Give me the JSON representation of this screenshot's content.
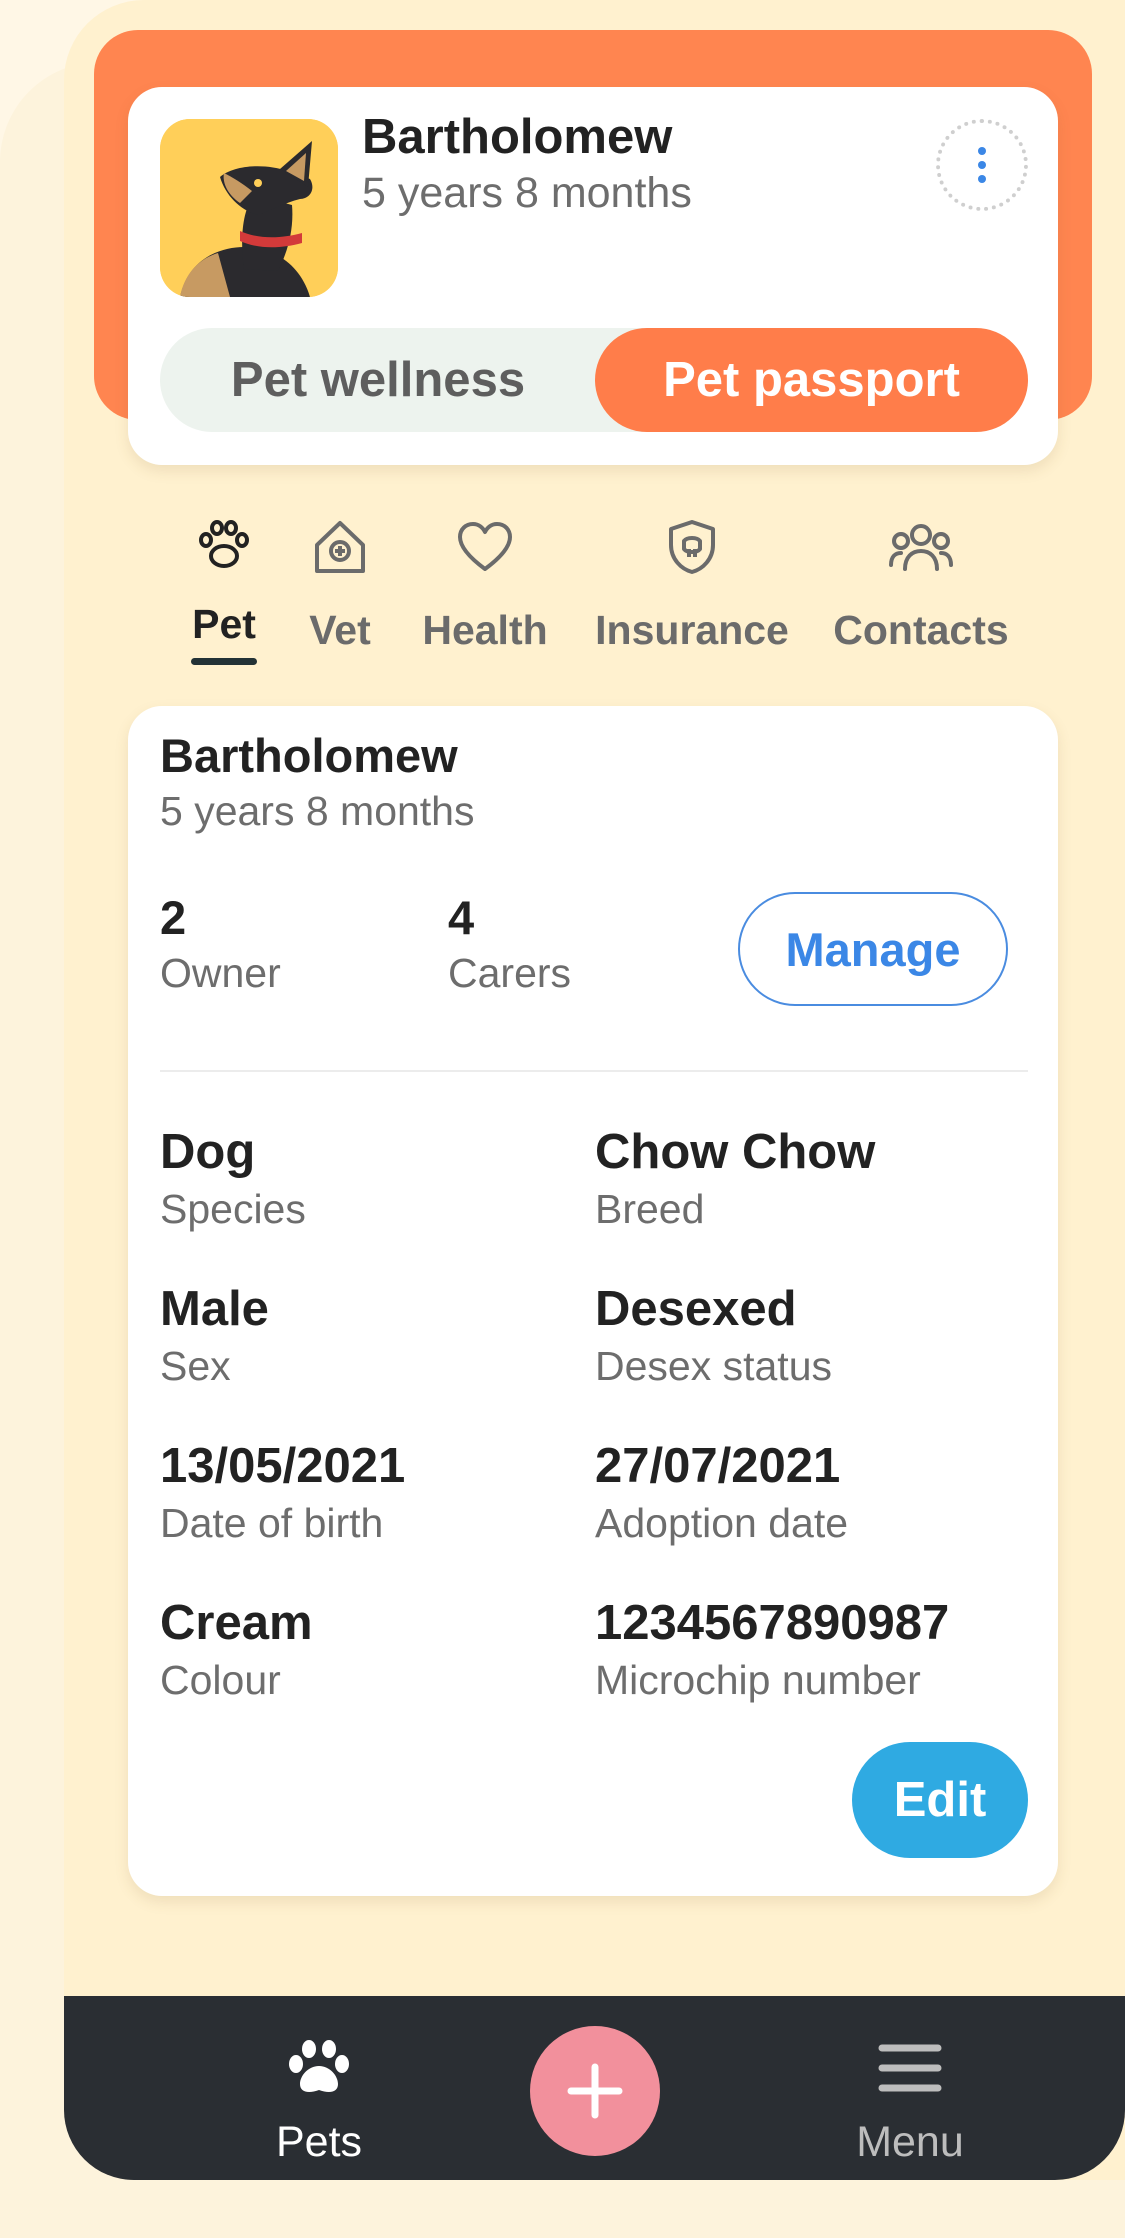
{
  "header": {
    "pet_name": "Bartholomew",
    "pet_age": "5 years 8 months",
    "segments": {
      "wellness_label": "Pet wellness",
      "passport_label": "Pet passport",
      "selected": "Pet passport"
    }
  },
  "tabs": [
    {
      "label": "Pet",
      "icon": "paw-icon",
      "active": true
    },
    {
      "label": "Vet",
      "icon": "vet-house-icon",
      "active": false
    },
    {
      "label": "Health",
      "icon": "heart-icon",
      "active": false
    },
    {
      "label": "Insurance",
      "icon": "shield-icon",
      "active": false
    },
    {
      "label": "Contacts",
      "icon": "people-icon",
      "active": false
    }
  ],
  "details": {
    "name": "Bartholomew",
    "age": "5 years 8 months",
    "owner_count": "2",
    "owner_label": "Owner",
    "carer_count": "4",
    "carer_label": "Carers",
    "manage_label": "Manage",
    "fields": [
      {
        "value": "Dog",
        "label": "Species"
      },
      {
        "value": "Chow Chow",
        "label": "Breed"
      },
      {
        "value": "Male",
        "label": "Sex"
      },
      {
        "value": "Desexed",
        "label": "Desex status"
      },
      {
        "value": "13/05/2021",
        "label": "Date of birth"
      },
      {
        "value": "27/07/2021",
        "label": "Adoption date"
      },
      {
        "value": "Cream",
        "label": "Colour"
      },
      {
        "value": "1234567890987",
        "label": "Microchip number"
      }
    ],
    "edit_label": "Edit"
  },
  "bottom_nav": {
    "pets_label": "Pets",
    "pets_icon": "paw-icon",
    "add_icon": "plus-icon",
    "menu_label": "Menu",
    "menu_icon": "hamburger-icon"
  },
  "colors": {
    "accent_orange": "#ff7d4a",
    "link_blue": "#3b87e6",
    "edit_blue": "#2faae2",
    "fab_pink": "#f2909c",
    "nav_dark": "#2a2e33",
    "background_cream": "#fff1cf"
  }
}
